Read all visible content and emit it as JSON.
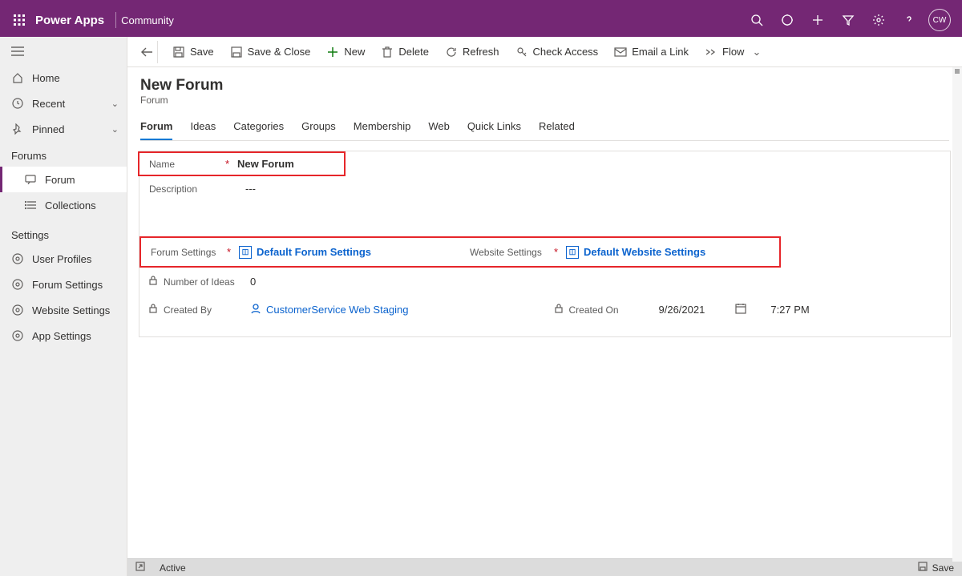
{
  "header": {
    "brand": "Power Apps",
    "environment": "Community",
    "avatar_initials": "CW"
  },
  "sidebar": {
    "home": "Home",
    "recent": "Recent",
    "pinned": "Pinned",
    "section1_header": "Forums",
    "forum": "Forum",
    "collections": "Collections",
    "section2_header": "Settings",
    "user_profiles": "User Profiles",
    "forum_settings": "Forum Settings",
    "website_settings": "Website Settings",
    "app_settings": "App Settings"
  },
  "cmdbar": {
    "save": "Save",
    "save_close": "Save & Close",
    "new": "New",
    "delete": "Delete",
    "refresh": "Refresh",
    "check_access": "Check Access",
    "email_link": "Email a Link",
    "flow": "Flow"
  },
  "form": {
    "title": "New Forum",
    "entity": "Forum",
    "tabs": [
      "Forum",
      "Ideas",
      "Categories",
      "Groups",
      "Membership",
      "Web",
      "Quick Links",
      "Related"
    ],
    "labels": {
      "name": "Name",
      "description": "Description",
      "forum_settings": "Forum Settings",
      "website_settings": "Website Settings",
      "number_of_ideas": "Number of Ideas",
      "created_by": "Created By",
      "created_on": "Created On"
    },
    "values": {
      "name": "New Forum",
      "description": "---",
      "forum_settings": "Default Forum Settings",
      "website_settings": "Default Website Settings",
      "number_of_ideas": "0",
      "created_by": "CustomerService Web Staging",
      "created_on_date": "9/26/2021",
      "created_on_time": "7:27 PM"
    }
  },
  "statusbar": {
    "status": "Active",
    "save": "Save"
  }
}
